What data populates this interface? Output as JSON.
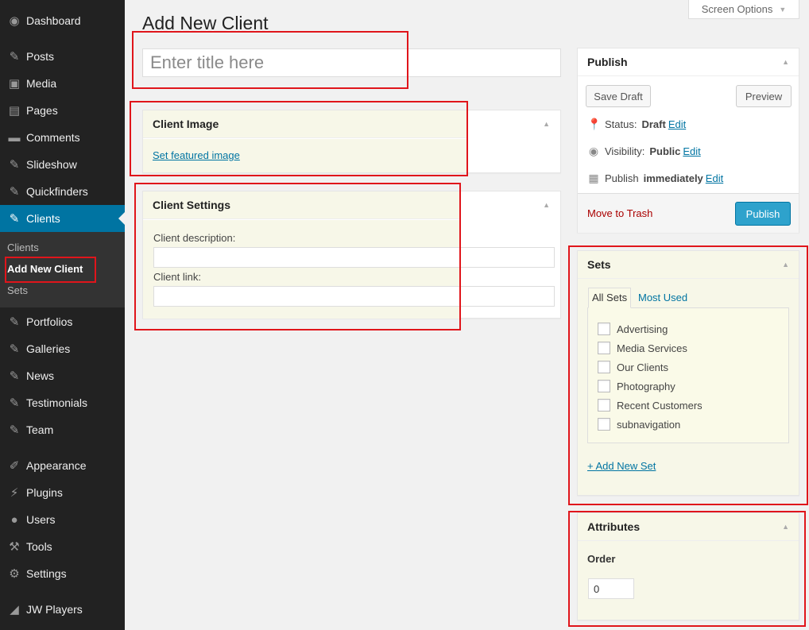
{
  "sidebar": {
    "items": [
      {
        "label": "Dashboard",
        "icon": "dashboard-icon",
        "glyph": "◉"
      },
      {
        "label": "Posts",
        "icon": "pin-icon",
        "glyph": "✎"
      },
      {
        "label": "Media",
        "icon": "media-icon",
        "glyph": "▣"
      },
      {
        "label": "Pages",
        "icon": "pages-icon",
        "glyph": "▤"
      },
      {
        "label": "Comments",
        "icon": "comment-icon",
        "glyph": "▬"
      },
      {
        "label": "Slideshow",
        "icon": "pin-icon",
        "glyph": "✎"
      },
      {
        "label": "Quickfinders",
        "icon": "pin-icon",
        "glyph": "✎"
      },
      {
        "label": "Clients",
        "icon": "pin-icon",
        "glyph": "✎"
      },
      {
        "label": "Portfolios",
        "icon": "pin-icon",
        "glyph": "✎"
      },
      {
        "label": "Galleries",
        "icon": "pin-icon",
        "glyph": "✎"
      },
      {
        "label": "News",
        "icon": "pin-icon",
        "glyph": "✎"
      },
      {
        "label": "Testimonials",
        "icon": "pin-icon",
        "glyph": "✎"
      },
      {
        "label": "Team",
        "icon": "pin-icon",
        "glyph": "✎"
      },
      {
        "label": "Appearance",
        "icon": "brush-icon",
        "glyph": "✐"
      },
      {
        "label": "Plugins",
        "icon": "plug-icon",
        "glyph": "⚡"
      },
      {
        "label": "Users",
        "icon": "user-icon",
        "glyph": "●"
      },
      {
        "label": "Tools",
        "icon": "wrench-icon",
        "glyph": "⚒"
      },
      {
        "label": "Settings",
        "icon": "settings-icon",
        "glyph": "⚙"
      },
      {
        "label": "JW Players",
        "icon": "player-icon",
        "glyph": "◢"
      }
    ],
    "submenu": [
      "Clients",
      "Add New Client",
      "Sets"
    ]
  },
  "header": {
    "title": "Add New Client",
    "screen_options": "Screen Options"
  },
  "title_field": {
    "placeholder": "Enter title here"
  },
  "client_image": {
    "title": "Client Image",
    "link": "Set featured image"
  },
  "client_settings": {
    "title": "Client Settings",
    "description_label": "Client description:",
    "link_label": "Client link:"
  },
  "publish": {
    "title": "Publish",
    "save_draft": "Save Draft",
    "preview": "Preview",
    "status_label": "Status:",
    "status_value": "Draft",
    "visibility_label": "Visibility:",
    "visibility_value": "Public",
    "publish_label": "Publish",
    "publish_value": "immediately",
    "edit": "Edit",
    "move_to_trash": "Move to Trash",
    "publish_button": "Publish"
  },
  "sets": {
    "title": "Sets",
    "tab_all": "All Sets",
    "tab_most_used": "Most Used",
    "items": [
      "Advertising",
      "Media Services",
      "Our Clients",
      "Photography",
      "Recent Customers",
      "subnavigation"
    ],
    "add_new": "+ Add New Set"
  },
  "attributes": {
    "title": "Attributes",
    "order_label": "Order",
    "order_value": "0"
  },
  "colors": {
    "sidebar_bg": "#222222",
    "active_menu": "#0074a2",
    "primary_button": "#2ea2cc",
    "highlight_box": "#e0151b",
    "trash_link": "#aa0000"
  }
}
